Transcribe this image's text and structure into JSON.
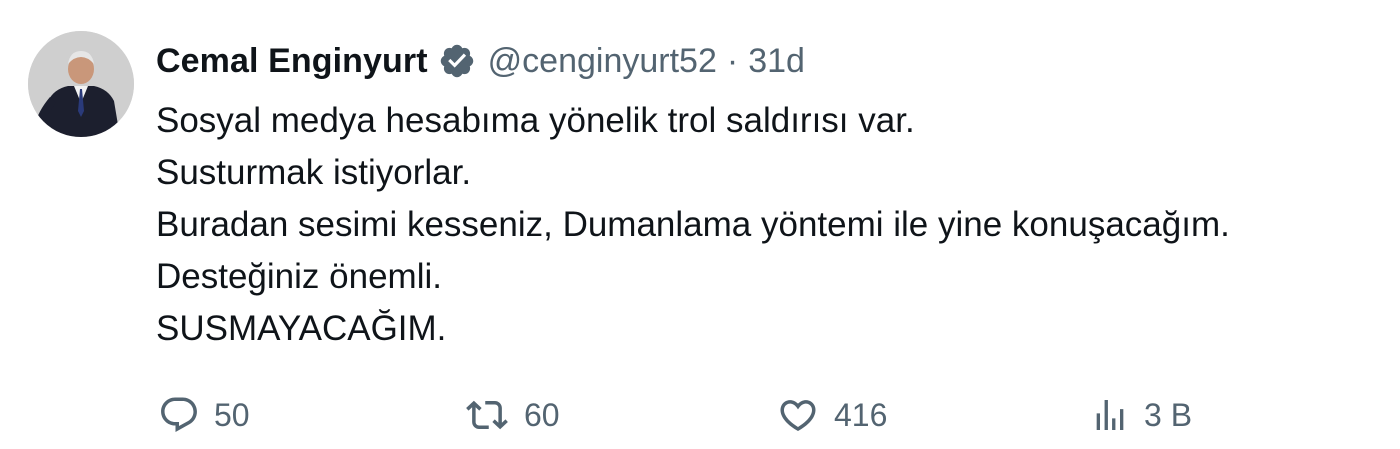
{
  "tweet": {
    "author_name": "Cemal Enginyurt",
    "handle": "@cenginyurt52",
    "separator": "·",
    "time": "31d",
    "verified": true,
    "lines": [
      "Sosyal medya hesabıma yönelik trol saldırısı var.",
      "Susturmak istiyorlar.",
      "Buradan sesimi kesseniz, Dumanlama yöntemi ile yine konuşacağım.",
      "Desteğiniz önemli.",
      "SUSMAYACAĞIM."
    ]
  },
  "actions": {
    "reply": {
      "icon": "reply-icon",
      "count": "50"
    },
    "retweet": {
      "icon": "retweet-icon",
      "count": "60"
    },
    "like": {
      "icon": "heart-icon",
      "count": "416"
    },
    "views": {
      "icon": "views-icon",
      "count": "3 B"
    }
  },
  "colors": {
    "text_primary": "#0f1419",
    "text_secondary": "#536471",
    "verified_badge": "#536471"
  }
}
